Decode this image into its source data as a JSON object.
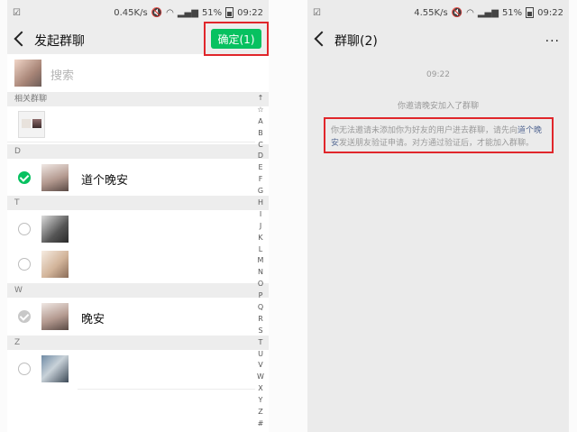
{
  "left": {
    "status": {
      "speed": "0.45K/s",
      "battery": "51%",
      "time": "09:22"
    },
    "title": "发起群聊",
    "confirm_label": "确定(1)",
    "search_placeholder": "搜索",
    "related_groups_header": "相关群聊",
    "sections": [
      {
        "letter": "D",
        "contacts": [
          {
            "name": "道个晚安",
            "state": "checked"
          }
        ]
      },
      {
        "letter": "T",
        "contacts": [
          {
            "name": "",
            "state": "unchecked"
          },
          {
            "name": "",
            "state": "unchecked"
          }
        ]
      },
      {
        "letter": "W",
        "contacts": [
          {
            "name": "晚安",
            "state": "checked-disabled"
          }
        ]
      },
      {
        "letter": "Z",
        "contacts": [
          {
            "name": "",
            "state": "unchecked"
          }
        ]
      }
    ],
    "alpha_index": [
      "↑",
      "☆",
      "A",
      "B",
      "C",
      "D",
      "E",
      "F",
      "G",
      "H",
      "I",
      "J",
      "K",
      "L",
      "M",
      "N",
      "O",
      "P",
      "Q",
      "R",
      "S",
      "T",
      "U",
      "V",
      "W",
      "X",
      "Y",
      "Z",
      "#"
    ]
  },
  "right": {
    "status": {
      "speed": "4.55K/s",
      "battery": "51%",
      "time": "09:22"
    },
    "title": "群聊(2)",
    "more_icon": "···",
    "time_label": "09:22",
    "invite_message": "你邀请晚安加入了群聊",
    "notice_part1": "你无法邀请未添加你为好友的用户进去群聊，请先向",
    "notice_link": "道个晚安",
    "notice_part2": "发送朋友验证申请。对方通过验证后，才能加入群聊。"
  },
  "colors": {
    "accent": "#07c160",
    "highlight_border": "#e0262b",
    "link": "#576b95"
  }
}
